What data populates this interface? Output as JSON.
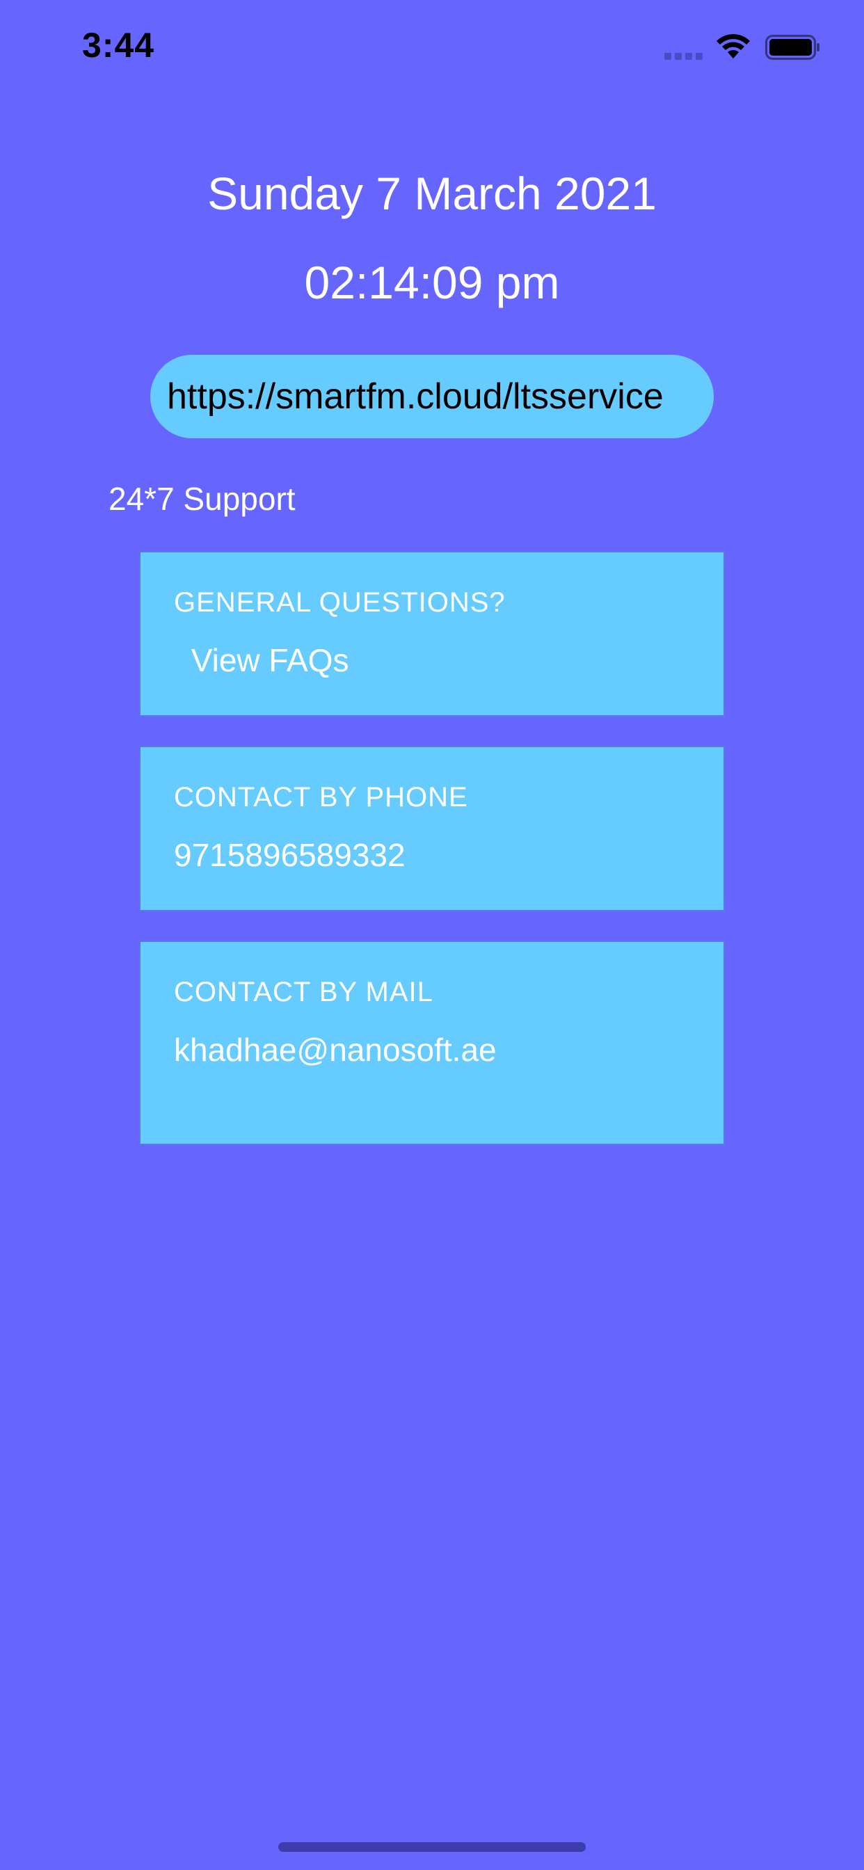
{
  "status_bar": {
    "time": "3:44"
  },
  "header": {
    "date": "Sunday 7 March 2021",
    "time": "02:14:09 pm"
  },
  "url_field": {
    "value": "https://smartfm.cloud/ltsservice"
  },
  "support": {
    "label": "24*7 Support",
    "cards": [
      {
        "title": "GENERAL QUESTIONS?",
        "value": " View FAQs"
      },
      {
        "title": "CONTACT BY PHONE",
        "value": "9715896589332"
      },
      {
        "title": "CONTACT BY MAIL",
        "value": "khadhae@nanosoft.ae"
      }
    ]
  },
  "colors": {
    "background": "#6666ff",
    "card": "#66ccff",
    "text": "#ffffff"
  }
}
